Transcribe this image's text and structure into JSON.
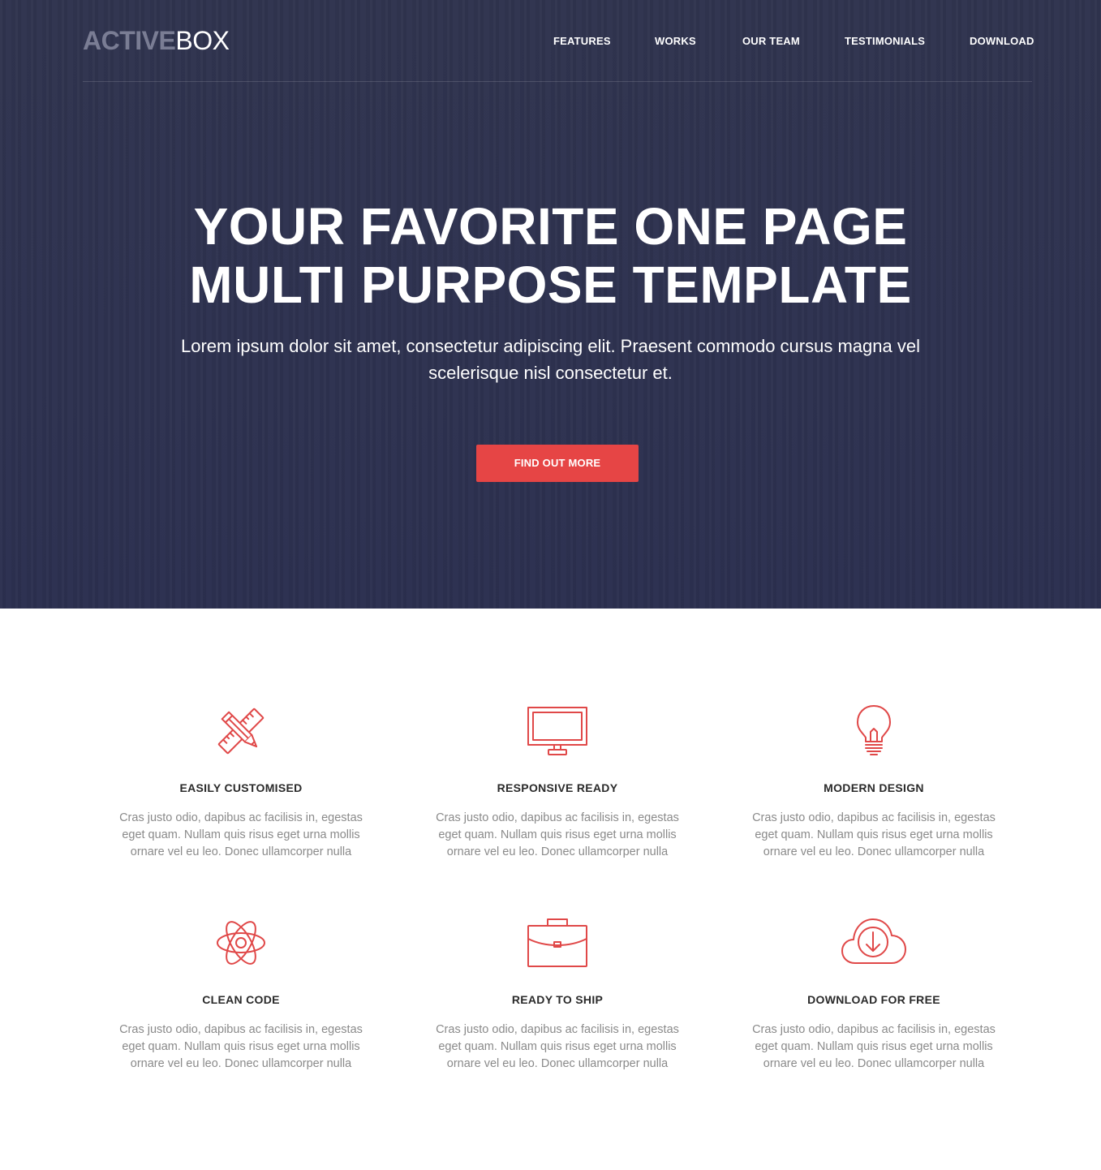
{
  "brand": {
    "strong": "ACTIVE",
    "light": "BOX"
  },
  "nav": {
    "items": [
      {
        "label": "FEATURES"
      },
      {
        "label": "WORKS"
      },
      {
        "label": "OUR TEAM"
      },
      {
        "label": "TESTIMONIALS"
      },
      {
        "label": "DOWNLOAD"
      }
    ]
  },
  "hero": {
    "title_line1": "YOUR FAVORITE ONE PAGE",
    "title_line2": "MULTI PURPOSE TEMPLATE",
    "subtitle": "Lorem ipsum dolor sit amet, consectetur adipiscing elit. Praesent commodo cursus magna vel scelerisque nisl consectetur et.",
    "button_label": "FIND OUT MORE"
  },
  "colors": {
    "hero_bg": "#2f3352",
    "accent": "#e64545",
    "icon_stroke": "#e04848",
    "heading_text": "#2a2a2a",
    "body_text": "#8a8a8a"
  },
  "features": [
    {
      "icon": "pencil-ruler-icon",
      "title": "EASILY CUSTOMISED",
      "text": "Cras justo odio, dapibus ac facilisis in, egestas eget quam. Nullam quis risus eget urna mollis ornare vel eu leo. Donec ullamcorper nulla"
    },
    {
      "icon": "monitor-icon",
      "title": "RESPONSIVE READY",
      "text": "Cras justo odio, dapibus ac facilisis in, egestas eget quam. Nullam quis risus eget urna mollis ornare vel eu leo. Donec ullamcorper nulla"
    },
    {
      "icon": "lightbulb-icon",
      "title": "MODERN DESIGN",
      "text": "Cras justo odio, dapibus ac facilisis in, egestas eget quam. Nullam quis risus eget urna mollis ornare vel eu leo. Donec ullamcorper nulla"
    },
    {
      "icon": "atom-icon",
      "title": "CLEAN CODE",
      "text": "Cras justo odio, dapibus ac facilisis in, egestas eget quam. Nullam quis risus eget urna mollis ornare vel eu leo. Donec ullamcorper nulla"
    },
    {
      "icon": "briefcase-icon",
      "title": "READY TO SHIP",
      "text": "Cras justo odio, dapibus ac facilisis in, egestas eget quam. Nullam quis risus eget urna mollis ornare vel eu leo. Donec ullamcorper nulla"
    },
    {
      "icon": "cloud-download-icon",
      "title": "DOWNLOAD FOR FREE",
      "text": "Cras justo odio, dapibus ac facilisis in, egestas eget quam. Nullam quis risus eget urna mollis ornare vel eu leo. Donec ullamcorper nulla"
    }
  ]
}
